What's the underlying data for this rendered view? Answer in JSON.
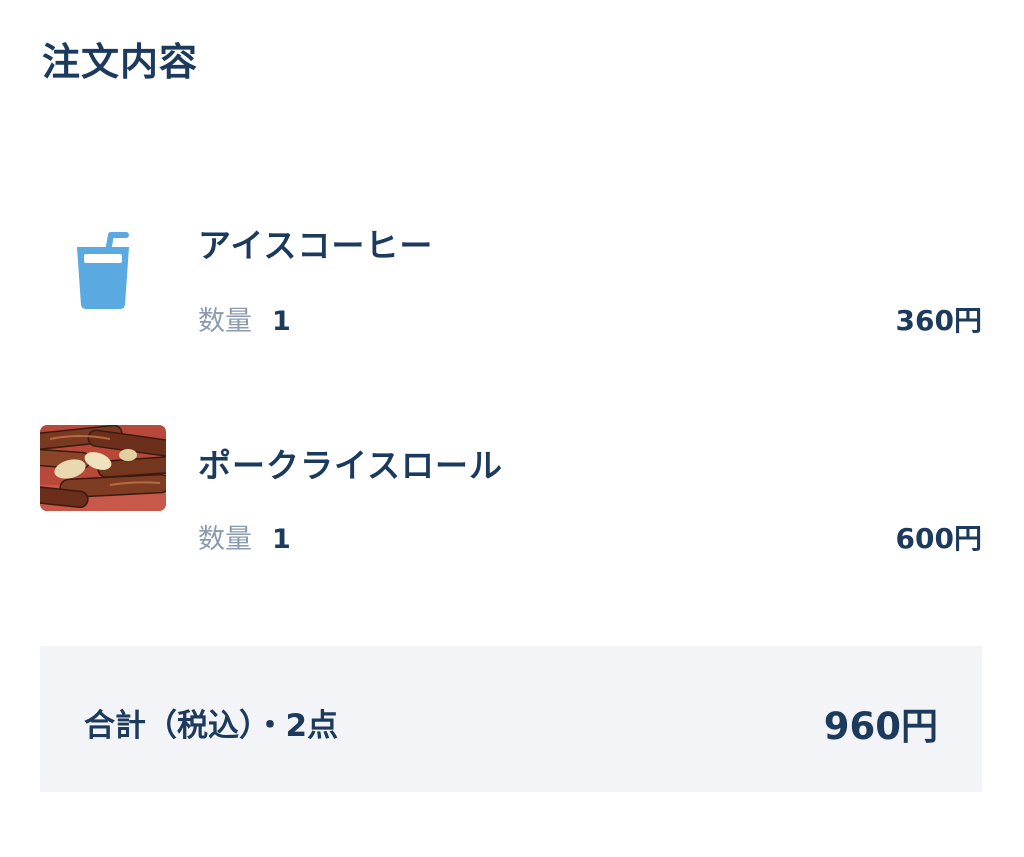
{
  "header": {
    "title": "注文内容"
  },
  "items": [
    {
      "name": "アイスコーヒー",
      "icon": "iced-drink-icon",
      "quantity_label": "数量",
      "quantity": "1",
      "price": "360円"
    },
    {
      "name": "ポークライスロール",
      "icon": "pork-rice-roll-photo",
      "quantity_label": "数量",
      "quantity": "1",
      "price": "600円"
    }
  ],
  "total": {
    "label": "合計（税込）・2点",
    "price": "960円"
  },
  "colors": {
    "text_primary": "#1b3a5c",
    "text_muted": "#8a9bb0",
    "icon_blue": "#5aa9e0",
    "total_background": "#f3f4f7"
  }
}
